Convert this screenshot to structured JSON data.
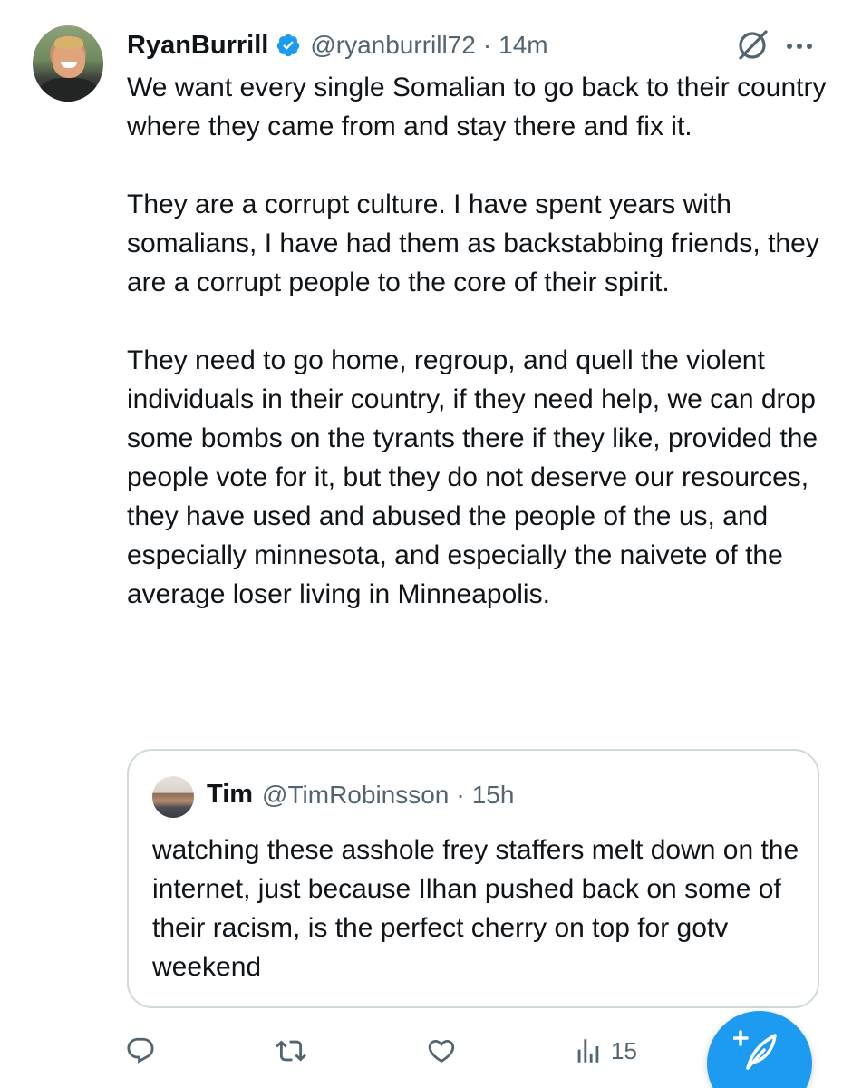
{
  "tweet": {
    "author": {
      "name": "RyanBurrill",
      "handle": "@ryanburrill72",
      "separator": "·",
      "time": "14m",
      "verified": true
    },
    "paragraphs": [
      "We want every single Somalian to go back to their country where they came from and stay there and fix it.",
      "They are a corrupt culture. I have spent years with somalians, I have had them as backstabbing friends, they are a corrupt people to the core of their spirit.",
      "They need to go home, regroup, and quell the violent individuals in their country, if they need help, we can drop some bombs on the tyrants there if they like, provided the people vote for it, but they do not deserve our resources, they have used and abused the people of the us, and especially minnesota, and especially the naivete of the average loser living in Minneapolis."
    ],
    "header_icons": [
      "grok-icon",
      "more-icon"
    ]
  },
  "quoted_tweet": {
    "name": "Tim",
    "handle": "@TimRobinsson",
    "separator": "·",
    "time": "15h",
    "text": "watching these asshole frey staffers melt down on the internet, just because Ilhan pushed back on some of their racism, is the perfect cherry on top for gotv weekend"
  },
  "actions": {
    "reply_icon": "reply-icon",
    "retweet_icon": "retweet-icon",
    "like_icon": "like-icon",
    "views_icon": "views-icon",
    "views_count": "15",
    "compose_icon": "compose-icon"
  },
  "colors": {
    "text": "#0f1419",
    "secondary": "#536471",
    "accent": "#1d9bf0",
    "border": "#cfd9de"
  }
}
